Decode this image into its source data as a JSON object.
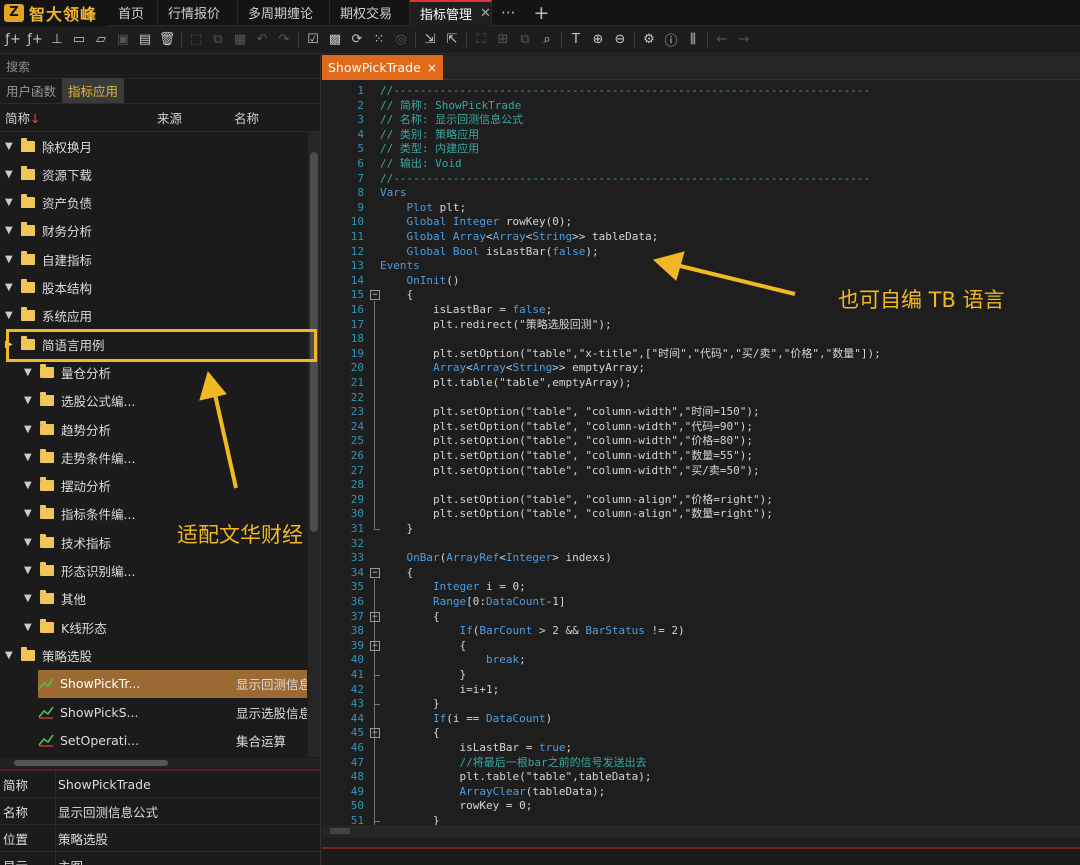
{
  "app": {
    "logo_mark": "Z",
    "logo_text": "智大领峰",
    "tabs": [
      {
        "label": "首页"
      },
      {
        "label": "行情报价"
      },
      {
        "label": "多周期缠论"
      },
      {
        "label": "期权交易"
      },
      {
        "label": "指标管理",
        "active": true
      }
    ],
    "more": "···",
    "add": "+"
  },
  "left": {
    "search_placeholder": "搜索",
    "subtabs": [
      "用户函数",
      "指标应用"
    ],
    "columns": {
      "short": "简称",
      "sort_arrow": "↓",
      "source": "来源",
      "name": "名称"
    },
    "tree": [
      {
        "label": "除权换月",
        "level": 0
      },
      {
        "label": "资源下载",
        "level": 0
      },
      {
        "label": "资产负债",
        "level": 0
      },
      {
        "label": "财务分析",
        "level": 0
      },
      {
        "label": "自建指标",
        "level": 0
      },
      {
        "label": "股本结构",
        "level": 0
      },
      {
        "label": "系统应用",
        "level": 0
      },
      {
        "label": "简语言用例",
        "level": 0
      },
      {
        "label": "量仓分析",
        "level": 1
      },
      {
        "label": "选股公式编...",
        "level": 1
      },
      {
        "label": "趋势分析",
        "level": 1
      },
      {
        "label": "走势条件编...",
        "level": 1
      },
      {
        "label": "摆动分析",
        "level": 1
      },
      {
        "label": "指标条件编...",
        "level": 1
      },
      {
        "label": "技术指标",
        "level": 1
      },
      {
        "label": "形态识别编...",
        "level": 1
      },
      {
        "label": "其他",
        "level": 1
      },
      {
        "label": "K线形态",
        "level": 1
      },
      {
        "label": "策略选股",
        "level": 0
      }
    ],
    "leaves": [
      {
        "label": "ShowPickTr...",
        "desc": "显示回测信息",
        "selected": true
      },
      {
        "label": "ShowPickS...",
        "desc": "显示选股信息"
      },
      {
        "label": "SetOperati...",
        "desc": "集合运算"
      }
    ],
    "props": [
      {
        "k": "简称",
        "v": "ShowPickTrade"
      },
      {
        "k": "名称",
        "v": "显示回测信息公式"
      },
      {
        "k": "位置",
        "v": "策略选股"
      },
      {
        "k": "显示",
        "v": "主图"
      }
    ]
  },
  "editor": {
    "tab": "ShowPickTrade",
    "tab_close": "×"
  },
  "annotations": {
    "tb_lang": "也可自编 TB 语言",
    "wenhua": "适配文华财经"
  },
  "code_lines": [
    "//------------------------------------------------------------------------",
    "// 简称: ShowPickTrade",
    "// 名称: 显示回测信息公式",
    "// 类别: 策略应用",
    "// 类型: 内建应用",
    "// 输出: Void",
    "//------------------------------------------------------------------------",
    "Vars",
    "    Plot plt;",
    "    Global Integer rowKey(0);",
    "    Global Array<Array<String>> tableData;",
    "    Global Bool isLastBar(false);",
    "Events",
    "    OnInit()",
    "    {",
    "        isLastBar = false;",
    "        plt.redirect(\"策略选股回测\");",
    "",
    "        plt.setOption(\"table\",\"x-title\",[\"时间\",\"代码\",\"买/卖\",\"价格\",\"数量\"]);",
    "        Array<Array<String>> emptyArray;",
    "        plt.table(\"table\",emptyArray);",
    "",
    "        plt.setOption(\"table\", \"column-width\",\"时间=150\");",
    "        plt.setOption(\"table\", \"column-width\",\"代码=90\");",
    "        plt.setOption(\"table\", \"column-width\",\"价格=80\");",
    "        plt.setOption(\"table\", \"column-width\",\"数量=55\");",
    "        plt.setOption(\"table\", \"column-width\",\"买/卖=50\");",
    "",
    "        plt.setOption(\"table\", \"column-align\",\"价格=right\");",
    "        plt.setOption(\"table\", \"column-align\",\"数量=right\");",
    "    }",
    "",
    "    OnBar(ArrayRef<Integer> indexs)",
    "    {",
    "        Integer i = 0;",
    "        Range[0:DataCount-1]",
    "        {",
    "            If(BarCount > 2 && BarStatus != 2)",
    "            {",
    "                break;",
    "            }",
    "            i=i+1;",
    "        }",
    "        If(i == DataCount)",
    "        {",
    "            isLastBar = true;",
    "            //将最后一根bar之前的信号发送出去",
    "            plt.table(\"table\",tableData);",
    "            ArrayClear(tableData);",
    "            rowKey = 0;",
    "        }",
    "    }"
  ]
}
